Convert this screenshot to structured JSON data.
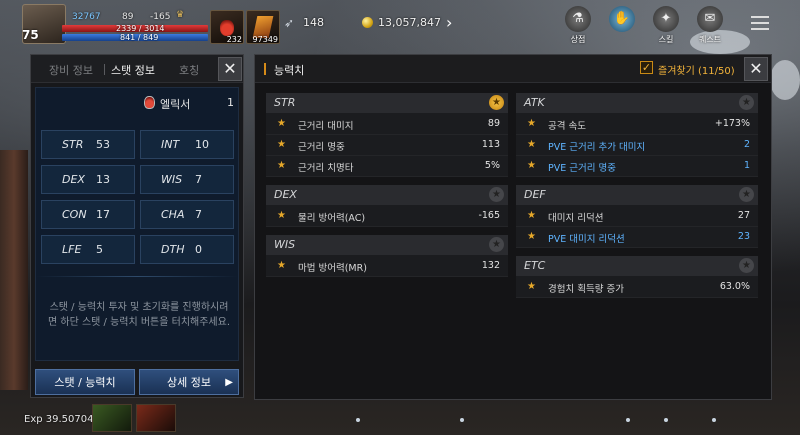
{
  "hud": {
    "level": "75",
    "power": "32767",
    "stat_a": "89",
    "stat_b": "-165",
    "hp": "2339 / 3014",
    "mp": "841 / 849",
    "potion_count": "232",
    "item_count": "97349",
    "wings_value": "148",
    "gold": "13,057,847",
    "menu": [
      {
        "label": "상점",
        "icon": "shop-icon"
      },
      {
        "label": "",
        "icon": "skill-book-icon"
      },
      {
        "label": "스킬",
        "icon": "skill-icon"
      },
      {
        "label": "퀘스트",
        "icon": "quest-icon"
      }
    ]
  },
  "left_panel": {
    "tabs": [
      "장비 정보",
      "스탯 정보",
      "호칭"
    ],
    "active_tab": "스탯 정보",
    "close_label": "✕",
    "elixir_label": "엘릭서",
    "elixir_count": "1",
    "stats": [
      {
        "name": "STR",
        "value": "53"
      },
      {
        "name": "INT",
        "value": "10"
      },
      {
        "name": "DEX",
        "value": "13"
      },
      {
        "name": "WIS",
        "value": "7"
      },
      {
        "name": "CON",
        "value": "17"
      },
      {
        "name": "CHA",
        "value": "7"
      },
      {
        "name": "LFE",
        "value": "5"
      },
      {
        "name": "DTH",
        "value": "0"
      }
    ],
    "description": "스탯 / 능력치 투자 및 초기화를 진행하시려면 하단 스탯 / 능력치 버튼을 터치해주세요.",
    "btn_stat": "스탯 / 능력치",
    "btn_detail": "상세 정보",
    "btn_detail_arrow": "▶"
  },
  "right_panel": {
    "title": "능력치",
    "favorites_label": "즐겨찾기 (11/50)",
    "check_mark": "✓",
    "close_label": "✕",
    "left_column": [
      {
        "title": "STR",
        "starred": true,
        "rows": [
          {
            "label": "근거리 대미지",
            "value": "89",
            "blue": false
          },
          {
            "label": "근거리 명중",
            "value": "113",
            "blue": false
          },
          {
            "label": "근거리 치명타",
            "value": "5%",
            "blue": false
          }
        ]
      },
      {
        "title": "DEX",
        "starred": false,
        "rows": [
          {
            "label": "물리 방어력(AC)",
            "value": "-165",
            "blue": false
          }
        ]
      },
      {
        "title": "WIS",
        "starred": false,
        "rows": [
          {
            "label": "마법 방어력(MR)",
            "value": "132",
            "blue": false
          }
        ]
      }
    ],
    "right_column": [
      {
        "title": "ATK",
        "starred": false,
        "rows": [
          {
            "label": "공격 속도",
            "value": "+173%",
            "blue": false
          },
          {
            "label": "PVE 근거리 추가 대미지",
            "value": "2",
            "blue": true
          },
          {
            "label": "PVE 근거리 명중",
            "value": "1",
            "blue": true
          }
        ]
      },
      {
        "title": "DEF",
        "starred": false,
        "rows": [
          {
            "label": "대미지 리덕션",
            "value": "27",
            "blue": false
          },
          {
            "label": "PVE 대미지 리덕션",
            "value": "23",
            "blue": true
          }
        ]
      },
      {
        "title": "ETC",
        "starred": false,
        "rows": [
          {
            "label": "경험치 획득량 증가",
            "value": "63.0%",
            "blue": false
          }
        ]
      }
    ]
  },
  "bottom": {
    "exp": "Exp 39.50704%"
  },
  "colors": {
    "accent_gold": "#f2b33a",
    "stat_blue": "#5fb4ff",
    "hp_red": "#e23b3b",
    "mp_blue": "#3b7be2"
  }
}
